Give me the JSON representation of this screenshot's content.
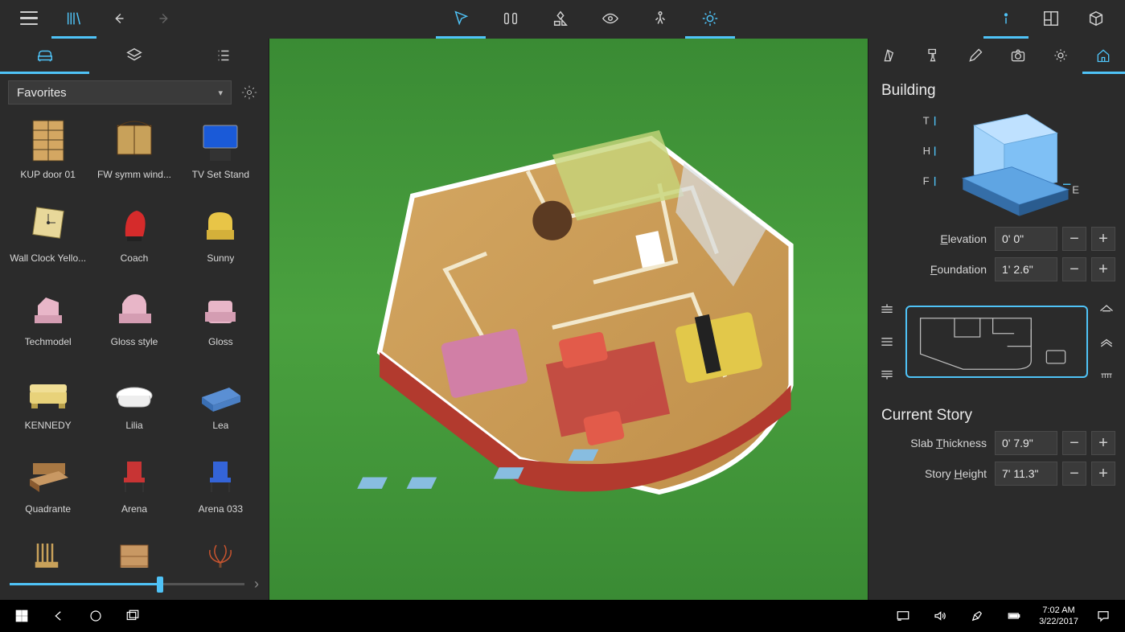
{
  "toolbar": {
    "active_top": [
      "library",
      "select",
      "sun",
      "info",
      "cube"
    ]
  },
  "library": {
    "category": "Favorites",
    "items": [
      {
        "label": "KUP door 01",
        "shape": "door"
      },
      {
        "label": "FW symm wind...",
        "shape": "window"
      },
      {
        "label": "TV Set Stand",
        "shape": "tv"
      },
      {
        "label": "Wall Clock Yello...",
        "shape": "clock"
      },
      {
        "label": "Coach",
        "shape": "chair-red"
      },
      {
        "label": "Sunny",
        "shape": "chair-yellow"
      },
      {
        "label": "Techmodel",
        "shape": "chair-pink"
      },
      {
        "label": "Gloss style",
        "shape": "chair-pink2"
      },
      {
        "label": "Gloss",
        "shape": "chair-pink3"
      },
      {
        "label": "KENNEDY",
        "shape": "sofa-yellow"
      },
      {
        "label": "Lilia",
        "shape": "tub"
      },
      {
        "label": "Lea",
        "shape": "bed-blue"
      },
      {
        "label": "Quadrante",
        "shape": "bed-brown"
      },
      {
        "label": "Arena",
        "shape": "chair-red2"
      },
      {
        "label": "Arena 033",
        "shape": "chair-blue"
      },
      {
        "label": "",
        "shape": "chair-wood"
      },
      {
        "label": "",
        "shape": "shelf"
      },
      {
        "label": "",
        "shape": "plant"
      }
    ]
  },
  "inspector": {
    "building_title": "Building",
    "current_story_title": "Current Story",
    "dim_labels": {
      "t": "T",
      "h": "H",
      "f": "F",
      "e": "E"
    },
    "elevation_label": "Elevation",
    "elevation_value": "0' 0\"",
    "foundation_label": "Foundation",
    "foundation_value": "1' 2.6\"",
    "slab_label": "Slab Thickness",
    "slab_value": "0' 7.9\"",
    "story_height_label": "Story Height",
    "story_height_value": "7' 11.3\""
  },
  "taskbar": {
    "time": "7:02 AM",
    "date": "3/22/2017"
  }
}
